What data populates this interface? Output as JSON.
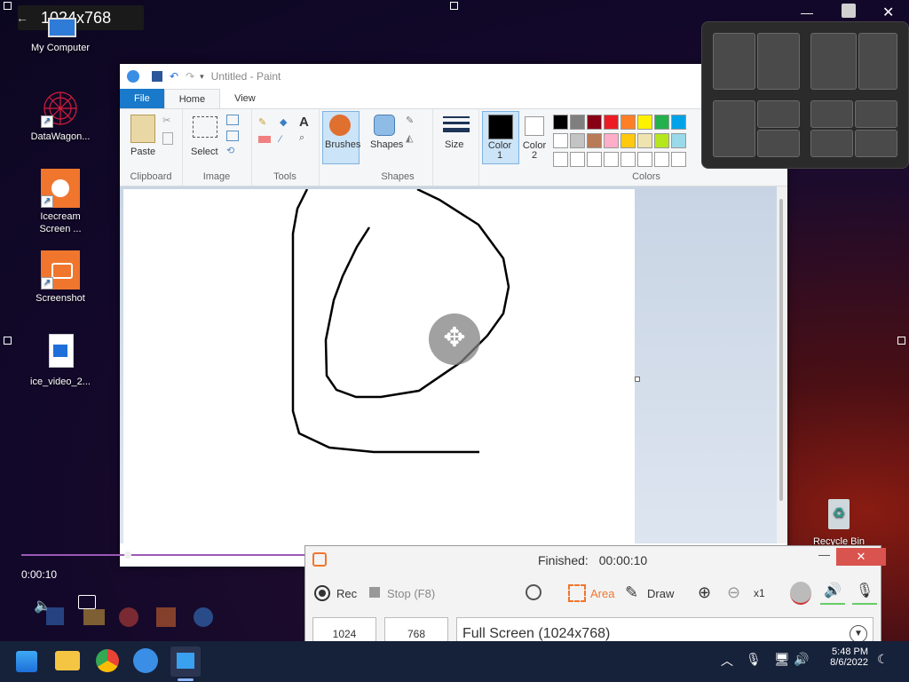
{
  "overlay": {
    "resolution_label": "1024x768",
    "back_glyph": "←"
  },
  "desktop": {
    "icons": [
      {
        "label": "My Computer"
      },
      {
        "label": "DataWagon..."
      },
      {
        "label": "Icecream Screen ..."
      },
      {
        "label": "Screenshot"
      },
      {
        "label": "ice_video_2..."
      },
      {
        "label": "Recycle Bin"
      }
    ]
  },
  "paint": {
    "title": "Untitled - Paint",
    "tabs": [
      {
        "label": "File"
      },
      {
        "label": "Home"
      },
      {
        "label": "View"
      }
    ],
    "groups": {
      "clipboard": "Clipboard",
      "image": "Image",
      "tools": "Tools",
      "shapes": "Shapes",
      "colors": "Colors"
    },
    "buttons": {
      "paste": "Paste",
      "select": "Select",
      "brushes": "Brushes",
      "shapes": "Shapes",
      "size": "Size",
      "color1": "Color\n1",
      "color2": "Color\n2"
    },
    "palette_row1": [
      "#000000",
      "#7f7f7f",
      "#880015",
      "#ed1c24",
      "#ff7f27",
      "#fff200",
      "#22b14c",
      "#00a2e8"
    ],
    "palette_row2": [
      "#ffffff",
      "#c3c3c3",
      "#b97a57",
      "#ffaec9",
      "#ffc90e",
      "#efe4b0",
      "#b5e61d",
      "#99d9ea"
    ]
  },
  "video": {
    "elapsed": "0:00:10"
  },
  "recorder": {
    "status_label": "Finished:",
    "status_time": "00:00:10",
    "rec_label": "Rec",
    "stop_label": "Stop (F8)",
    "area_label": "Area",
    "draw_label": "Draw",
    "zoom_label": "x1",
    "width": "1024",
    "height": "768",
    "mode": "Full Screen (1024x768)",
    "accent": "#f0762e"
  },
  "taskbar": {
    "date": "8/6/2022",
    "time": "5:48 PM"
  }
}
